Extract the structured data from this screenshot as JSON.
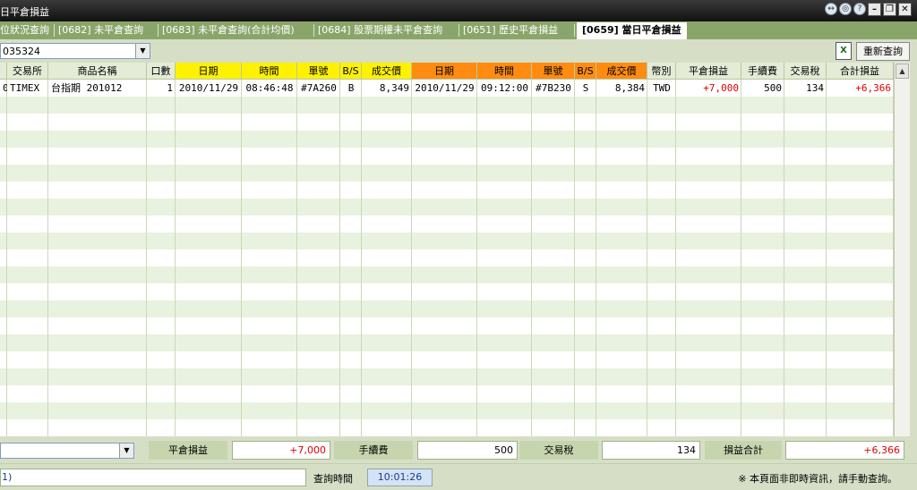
{
  "window": {
    "title": "日平倉損益"
  },
  "tabs": [
    {
      "label": "位狀況查詢"
    },
    {
      "label": "[0682] 未平倉查詢"
    },
    {
      "label": "[0683] 未平倉查詢(合計均價)"
    },
    {
      "label": "[0684] 股票期權未平倉查詢"
    },
    {
      "label": "[0651] 歷史平倉損益"
    },
    {
      "label": "[0659] 當日平倉損益"
    }
  ],
  "toolbar": {
    "account": "035324",
    "refresh_label": "重新查詢",
    "excel_icon": "excel-icon"
  },
  "table": {
    "headers": [
      "",
      "交易所",
      "商品名稱",
      "口數",
      "日期",
      "時間",
      "單號",
      "B/S",
      "成交價",
      "日期",
      "時間",
      "單號",
      "B/S",
      "成交價",
      "幣別",
      "平倉損益",
      "手續費",
      "交易稅",
      "合計損益"
    ],
    "rows": [
      [
        "0",
        "TIMEX",
        "台指期 201012",
        "1",
        "2010/11/29",
        "08:46:48",
        "#7A260",
        "B",
        "8,349",
        "2010/11/29",
        "09:12:00",
        "#7B230",
        "S",
        "8,384",
        "TWD",
        "+7,000",
        "500",
        "134",
        "+6,366"
      ]
    ]
  },
  "summary": {
    "pl_label": "平倉損益",
    "pl_value": "+7,000",
    "fee_label": "手續費",
    "fee_value": "500",
    "tax_label": "交易稅",
    "tax_value": "134",
    "total_label": "損益合計",
    "total_value": "+6,366"
  },
  "status": {
    "message": "1)",
    "query_time_label": "查詢時間",
    "query_time": "10:01:26",
    "notice": "※ 本頁面非即時資訊，請手動查詢。"
  },
  "colors": {
    "accent_green": "#8aa56a",
    "header_yellow": "#fff200",
    "header_orange": "#ff8c10",
    "profit_red": "#e00000"
  }
}
